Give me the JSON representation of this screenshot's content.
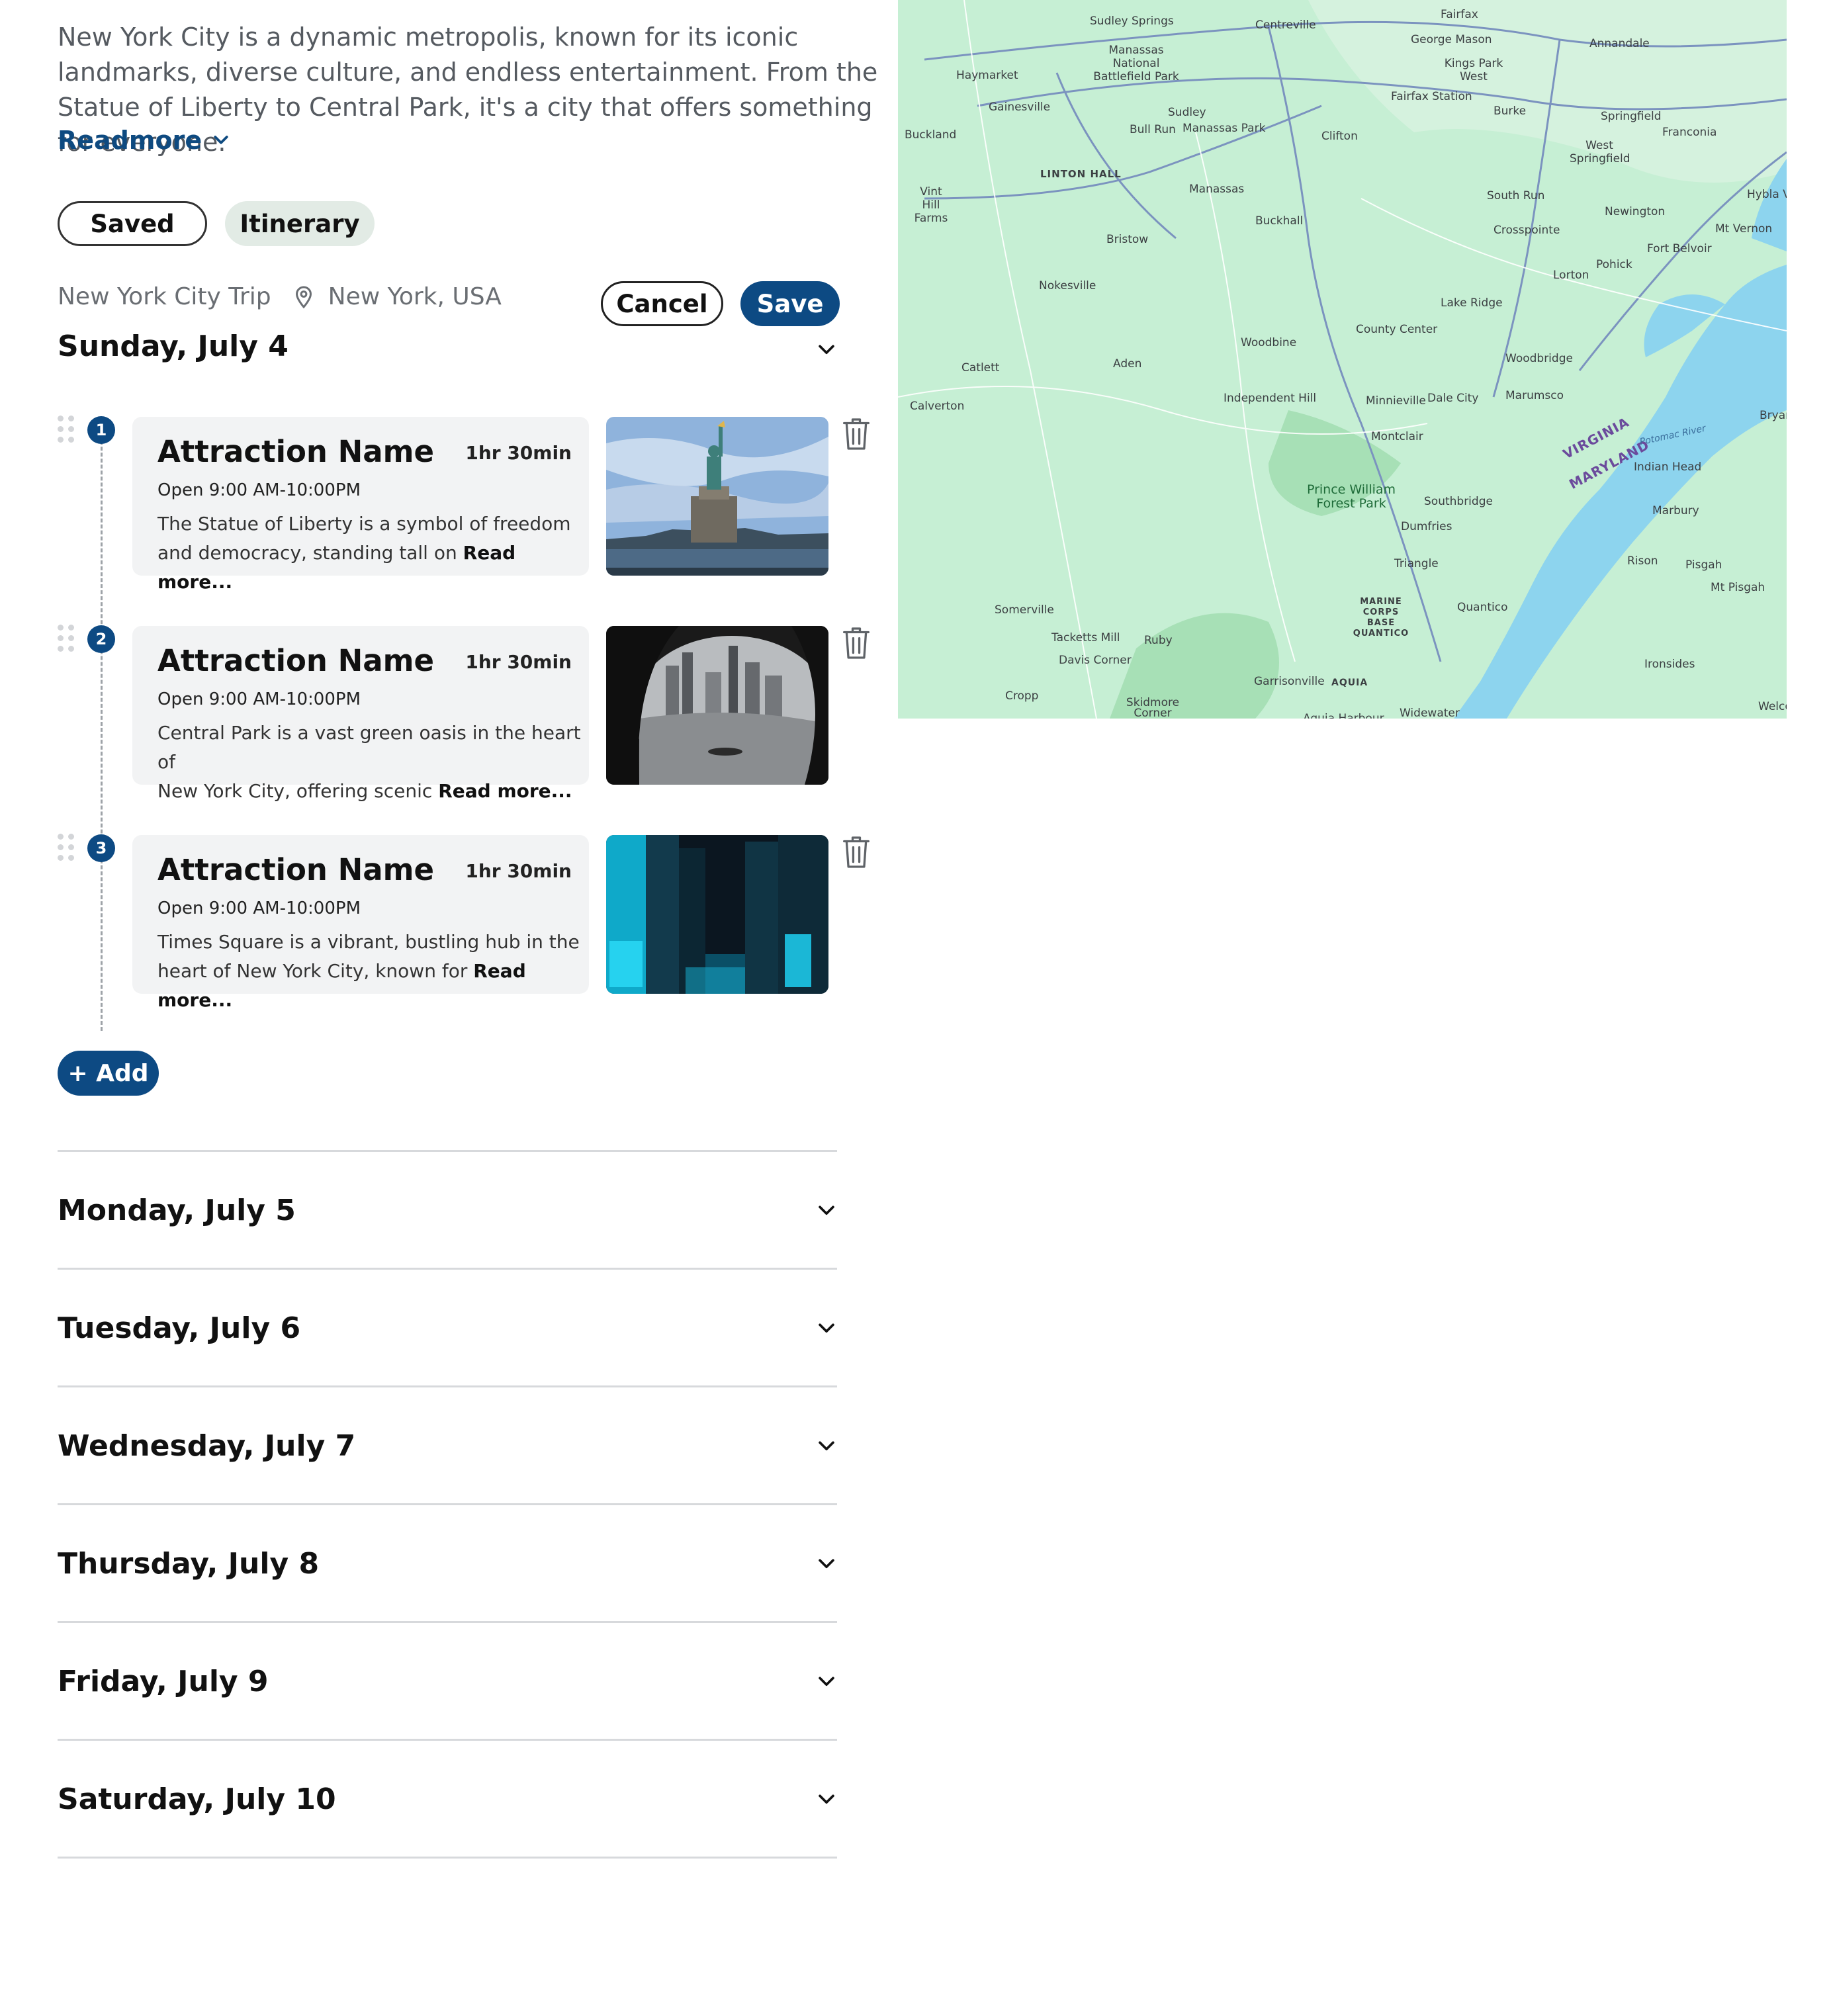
{
  "intro": {
    "text": "New York City is a dynamic metropolis, known for its iconic landmarks, diverse culture, and endless entertainment. From the Statue of Liberty to Central Park, it's a city that offers something for everyone.",
    "readmore_label": "Readmore"
  },
  "tabs": [
    {
      "label": "Saved",
      "active": false
    },
    {
      "label": "Itinerary",
      "active": true
    }
  ],
  "trip": {
    "name": "New York City Trip",
    "location": "New York, USA",
    "cancel_label": "Cancel",
    "save_label": "Save"
  },
  "expanded_day": {
    "title": "Sunday, July 4",
    "items": [
      {
        "number": "1",
        "name": "Attraction Name",
        "duration": "1hr 30min",
        "hours": "Open 9:00 AM-10:00PM",
        "desc_line1": "The Statue of Liberty is a symbol of freedom",
        "desc_line2": "and democracy, standing tall on",
        "read_more": "Read more..."
      },
      {
        "number": "2",
        "name": "Attraction Name",
        "duration": "1hr 30min",
        "hours": "Open 9:00 AM-10:00PM",
        "desc_line1": "Central Park is a vast green oasis in the heart of",
        "desc_line2": "New York City, offering scenic",
        "read_more": "Read more..."
      },
      {
        "number": "3",
        "name": "Attraction Name",
        "duration": "1hr 30min",
        "hours": "Open 9:00 AM-10:00PM",
        "desc_line1": "Times Square is a vibrant, bustling hub in the",
        "desc_line2": "heart of New York City, known for",
        "read_more": "Read more..."
      }
    ],
    "add_label": "+ Add"
  },
  "collapsed_days": [
    {
      "title": "Monday, July 5"
    },
    {
      "title": "Tuesday, July 6"
    },
    {
      "title": "Wednesday, July 7"
    },
    {
      "title": "Thursday, July 8"
    },
    {
      "title": "Friday, July 9"
    },
    {
      "title": "Saturday, July 10"
    }
  ],
  "map": {
    "labels": [
      "Sudley Springs",
      "Centreville",
      "Fairfax",
      "George Mason",
      "Annandale",
      "Manassas National Battlefield Park",
      "Kings Park West",
      "Haymarket",
      "Gainesville",
      "Fairfax Station",
      "Sudley",
      "Burke",
      "Springfield",
      "Franconia",
      "Bull Run",
      "Manassas Park",
      "Clifton",
      "West Springfield",
      "Buckland",
      "LINTON HALL",
      "Manassas",
      "South Run",
      "Hybla V",
      "Vint Hill Farms",
      "Newington",
      "Mt Vernon",
      "Bristow",
      "Buckhall",
      "Crosspointe",
      "Fort Belvoir",
      "Pohick",
      "Lorton",
      "Nokesville",
      "Lake Ridge",
      "Woodbine",
      "County Center",
      "Woodbridge",
      "Catlett",
      "Aden",
      "Independent Hill",
      "Minnieville",
      "Dale City",
      "Marumsco",
      "Calverton",
      "Montclair",
      "VIRGINIA",
      "MARYLAND",
      "Potomac River",
      "Bryan",
      "Indian Head",
      "Prince William Forest Park",
      "Southbridge",
      "Marbury",
      "Dumfries",
      "Triangle",
      "Rison",
      "Pisgah",
      "Mt Pisgah",
      "Somerville",
      "MARINE CORPS BASE QUANTICO",
      "Quantico",
      "Tacketts Mill",
      "Ruby",
      "Davis Corner",
      "Ironsides",
      "Garrisonville",
      "AQUIA",
      "Cropp",
      "Skidmore Corner",
      "Aquia Harbour",
      "Widewater",
      "Welco"
    ],
    "water_color": "#8dd4ee",
    "land_color": "#c6efd4",
    "park_color": "#a7e0b6"
  },
  "colors": {
    "primary": "#0d4a83",
    "tab_active_bg": "#e2ebe5",
    "card_bg": "#f2f3f4"
  }
}
